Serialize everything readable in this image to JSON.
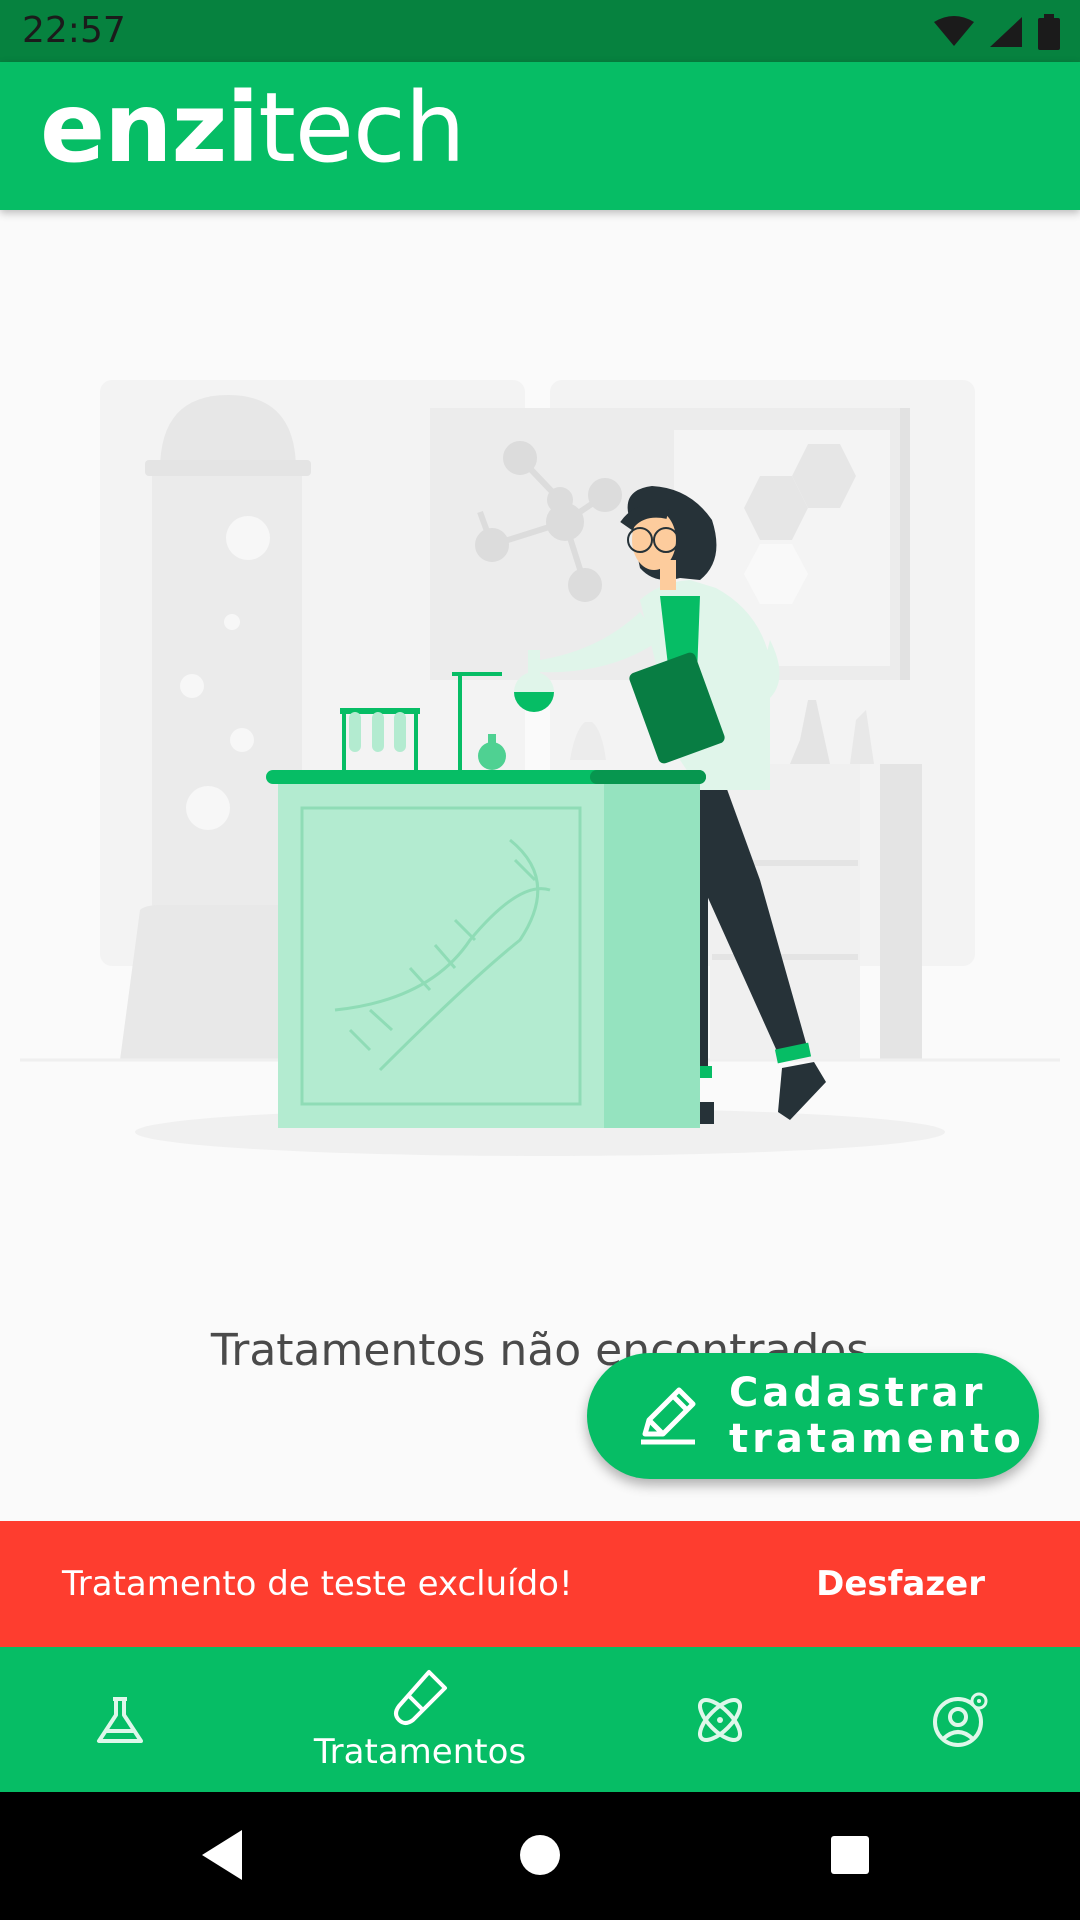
{
  "status_bar": {
    "time": "22:57"
  },
  "app_bar": {
    "logo_bold": "enzi",
    "logo_light": "tech"
  },
  "empty_state": {
    "message": "Tratamentos não encontrados"
  },
  "fab": {
    "label": "Cadastrar tratamento"
  },
  "snackbar": {
    "message": "Tratamento de teste excluído!",
    "action": "Desfazer"
  },
  "bottom_nav": {
    "items": [
      {
        "icon": "flask-icon",
        "label": ""
      },
      {
        "icon": "test-tube-icon",
        "label": "Tratamentos"
      },
      {
        "icon": "atom-icon",
        "label": ""
      },
      {
        "icon": "user-settings-icon",
        "label": ""
      }
    ]
  },
  "colors": {
    "primary": "#06bd65",
    "status": "#06823f",
    "snackbar": "#fe3d2f",
    "background": "#fafafa"
  }
}
